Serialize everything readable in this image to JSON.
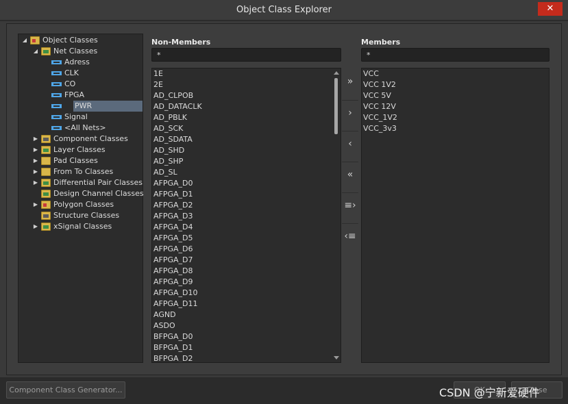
{
  "window": {
    "title": "Object Class Explorer",
    "close_glyph": "✕"
  },
  "tree": {
    "rows": [
      {
        "label": "Object Classes",
        "twisty": "◢",
        "icon": "object-classes-icon"
      },
      {
        "label": "Net Classes",
        "twisty": "◢",
        "icon": "net-classes-folder-icon"
      },
      {
        "label": "Adress",
        "twisty": "",
        "icon": "net-class-icon"
      },
      {
        "label": "CLK",
        "twisty": "",
        "icon": "net-class-icon"
      },
      {
        "label": "CO",
        "twisty": "",
        "icon": "net-class-icon"
      },
      {
        "label": "FPGA",
        "twisty": "",
        "icon": "net-class-icon"
      },
      {
        "label": "PWR",
        "twisty": "",
        "icon": "net-class-icon",
        "selected": true
      },
      {
        "label": "Signal",
        "twisty": "",
        "icon": "net-class-icon"
      },
      {
        "label": "<All Nets>",
        "twisty": "",
        "icon": "net-class-icon"
      },
      {
        "label": "Component Classes",
        "twisty": "▶",
        "icon": "component-classes-folder-icon"
      },
      {
        "label": "Layer Classes",
        "twisty": "▶",
        "icon": "layer-classes-folder-icon"
      },
      {
        "label": "Pad Classes",
        "twisty": "▶",
        "icon": "pad-classes-folder-icon"
      },
      {
        "label": "From To Classes",
        "twisty": "▶",
        "icon": "from-to-classes-folder-icon"
      },
      {
        "label": "Differential Pair Classes",
        "twisty": "▶",
        "icon": "differential-pair-classes-folder-icon"
      },
      {
        "label": "Design Channel Classes",
        "twisty": "",
        "icon": "design-channel-classes-folder-icon"
      },
      {
        "label": "Polygon Classes",
        "twisty": "▶",
        "icon": "polygon-classes-folder-icon"
      },
      {
        "label": "Structure Classes",
        "twisty": "",
        "icon": "structure-classes-folder-icon"
      },
      {
        "label": "xSignal Classes",
        "twisty": "▶",
        "icon": "xsignal-classes-folder-icon"
      }
    ]
  },
  "non_members": {
    "caption": "Non-Members",
    "filter_value": "*",
    "items": [
      "1E",
      "2E",
      "AD_CLPOB",
      "AD_DATACLK",
      "AD_PBLK",
      "AD_SCK",
      "AD_SDATA",
      "AD_SHD",
      "AD_SHP",
      "AD_SL",
      "AFPGA_D0",
      "AFPGA_D1",
      "AFPGA_D2",
      "AFPGA_D3",
      "AFPGA_D4",
      "AFPGA_D5",
      "AFPGA_D6",
      "AFPGA_D7",
      "AFPGA_D8",
      "AFPGA_D9",
      "AFPGA_D10",
      "AFPGA_D11",
      "AGND",
      "ASDO",
      "BFPGA_D0",
      "BFPGA_D1",
      "BFPGA_D2"
    ]
  },
  "members": {
    "caption": "Members",
    "filter_value": "*",
    "items": [
      "VCC",
      "VCC 1V2",
      "VCC 5V",
      "VCC 12V",
      "VCC_1V2",
      "VCC_3v3"
    ]
  },
  "move_buttons": [
    {
      "name": "move-all-to-members-button",
      "glyph": "»"
    },
    {
      "name": "move-to-members-button",
      "glyph": "›"
    },
    {
      "name": "move-to-non-members-button",
      "glyph": "‹"
    },
    {
      "name": "move-all-to-non-members-button",
      "glyph": "«"
    },
    {
      "name": "move-filtered-to-members-button",
      "glyph": "≡›"
    },
    {
      "name": "move-filtered-to-non-members-button",
      "glyph": "‹≡"
    }
  ],
  "footer": {
    "generator_label": "Component Class Generator...",
    "ok_label": "OK",
    "close_label": "Close"
  },
  "watermark": "CSDN @宁新爱硬件"
}
